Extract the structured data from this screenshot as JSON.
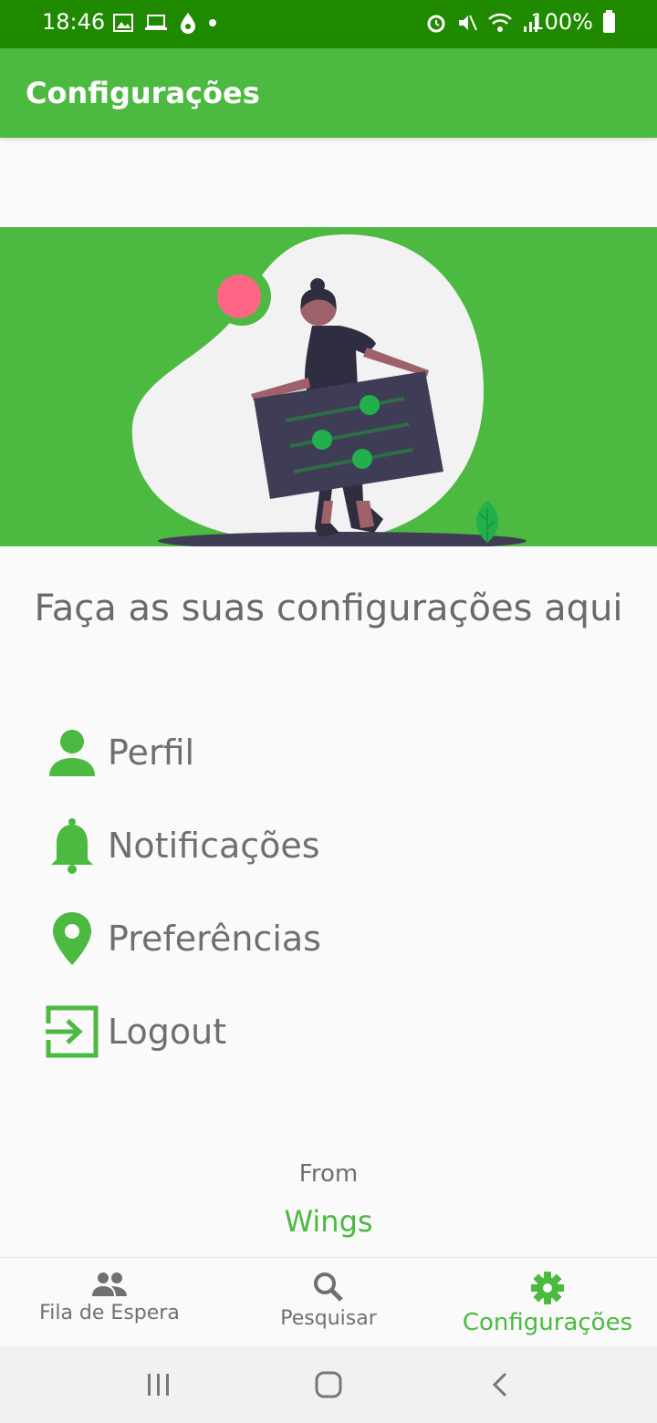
{
  "status": {
    "time": "18:46",
    "battery": "100%"
  },
  "appbar": {
    "title": "Configurações"
  },
  "headline": "Faça as suas configurações aqui",
  "menu": [
    {
      "label": "Perfil",
      "icon": "person-icon"
    },
    {
      "label": "Notificações",
      "icon": "bell-icon"
    },
    {
      "label": "Preferências",
      "icon": "location-pin-icon"
    },
    {
      "label": "Logout",
      "icon": "logout-icon"
    }
  ],
  "footer": {
    "from": "From",
    "brand": "Wings"
  },
  "bottom_nav": [
    {
      "label": "Fila de Espera",
      "icon": "people-icon",
      "active": false
    },
    {
      "label": "Pesquisar",
      "icon": "search-icon",
      "active": false
    },
    {
      "label": "Configurações",
      "icon": "gear-icon",
      "active": true
    }
  ],
  "colors": {
    "primary": "#4cb940",
    "status_bar": "#1f8a00",
    "text": "#6f6f6f"
  }
}
